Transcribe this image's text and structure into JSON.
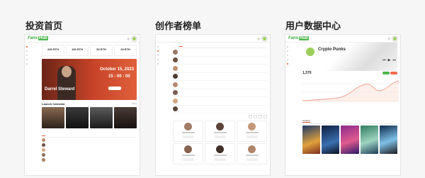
{
  "sections": [
    {
      "title": "投资首页"
    },
    {
      "title": "创作者榜单"
    },
    {
      "title": "用户数据中心"
    }
  ],
  "home": {
    "logo": "Fans",
    "logo_tag": "Hub",
    "stats": [
      {
        "value": "200 ETH"
      },
      {
        "value": "100 ETH"
      },
      {
        "value": "50 ETH"
      },
      {
        "value": "20 ETH"
      }
    ],
    "hero": {
      "name": "Darrel Steward",
      "date": "October 15, 2023",
      "time": "15 : 00 : 00"
    },
    "launch_title": "Launch Calendar",
    "more": "More"
  },
  "profile": {
    "name": "Crypto Punks",
    "stat_main": "1,370",
    "tab_content": "Content"
  },
  "colors": {
    "accent": "#e2572b",
    "brand": "#4cb74c"
  }
}
